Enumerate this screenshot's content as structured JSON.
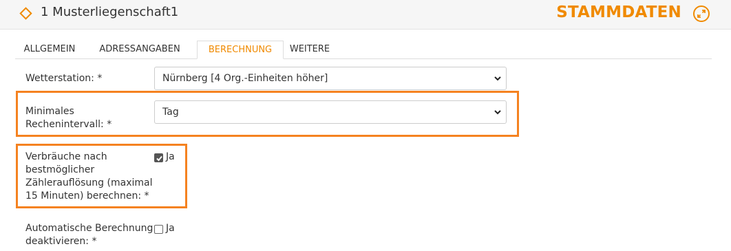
{
  "header": {
    "title": "1 Musterliegenschaft1",
    "section": "STAMMDATEN",
    "accent_color": "#f08a00",
    "icons": [
      "diamond-icon",
      "expand-icon"
    ]
  },
  "tabs": [
    {
      "label": "ALLGEMEIN",
      "active": false
    },
    {
      "label": "ADRESSANGABEN",
      "active": false
    },
    {
      "label": "BERECHNUNG",
      "active": true
    },
    {
      "label": "WEITERE",
      "active": false
    }
  ],
  "form": {
    "weather_station": {
      "label": "Wetterstation: *",
      "value": "Nürnberg [4 Org.-Einheiten höher]"
    },
    "min_interval": {
      "label_line1": "Minimales",
      "label_line2": "Rechenintervall: *",
      "value": "Tag"
    },
    "consumption": {
      "label_line1": "Verbräuche nach",
      "label_line2": "bestmöglicher",
      "label_line3": "Zählerauflösung (maximal",
      "label_line4": "15 Minuten) berechnen: *",
      "checked": true,
      "option_label": "Ja"
    },
    "auto_calc": {
      "label_line1": "Automatische Berechnung",
      "label_line2": "deaktivieren: *",
      "checked": false,
      "option_label": "Ja"
    }
  },
  "highlight_color": "#f58220"
}
